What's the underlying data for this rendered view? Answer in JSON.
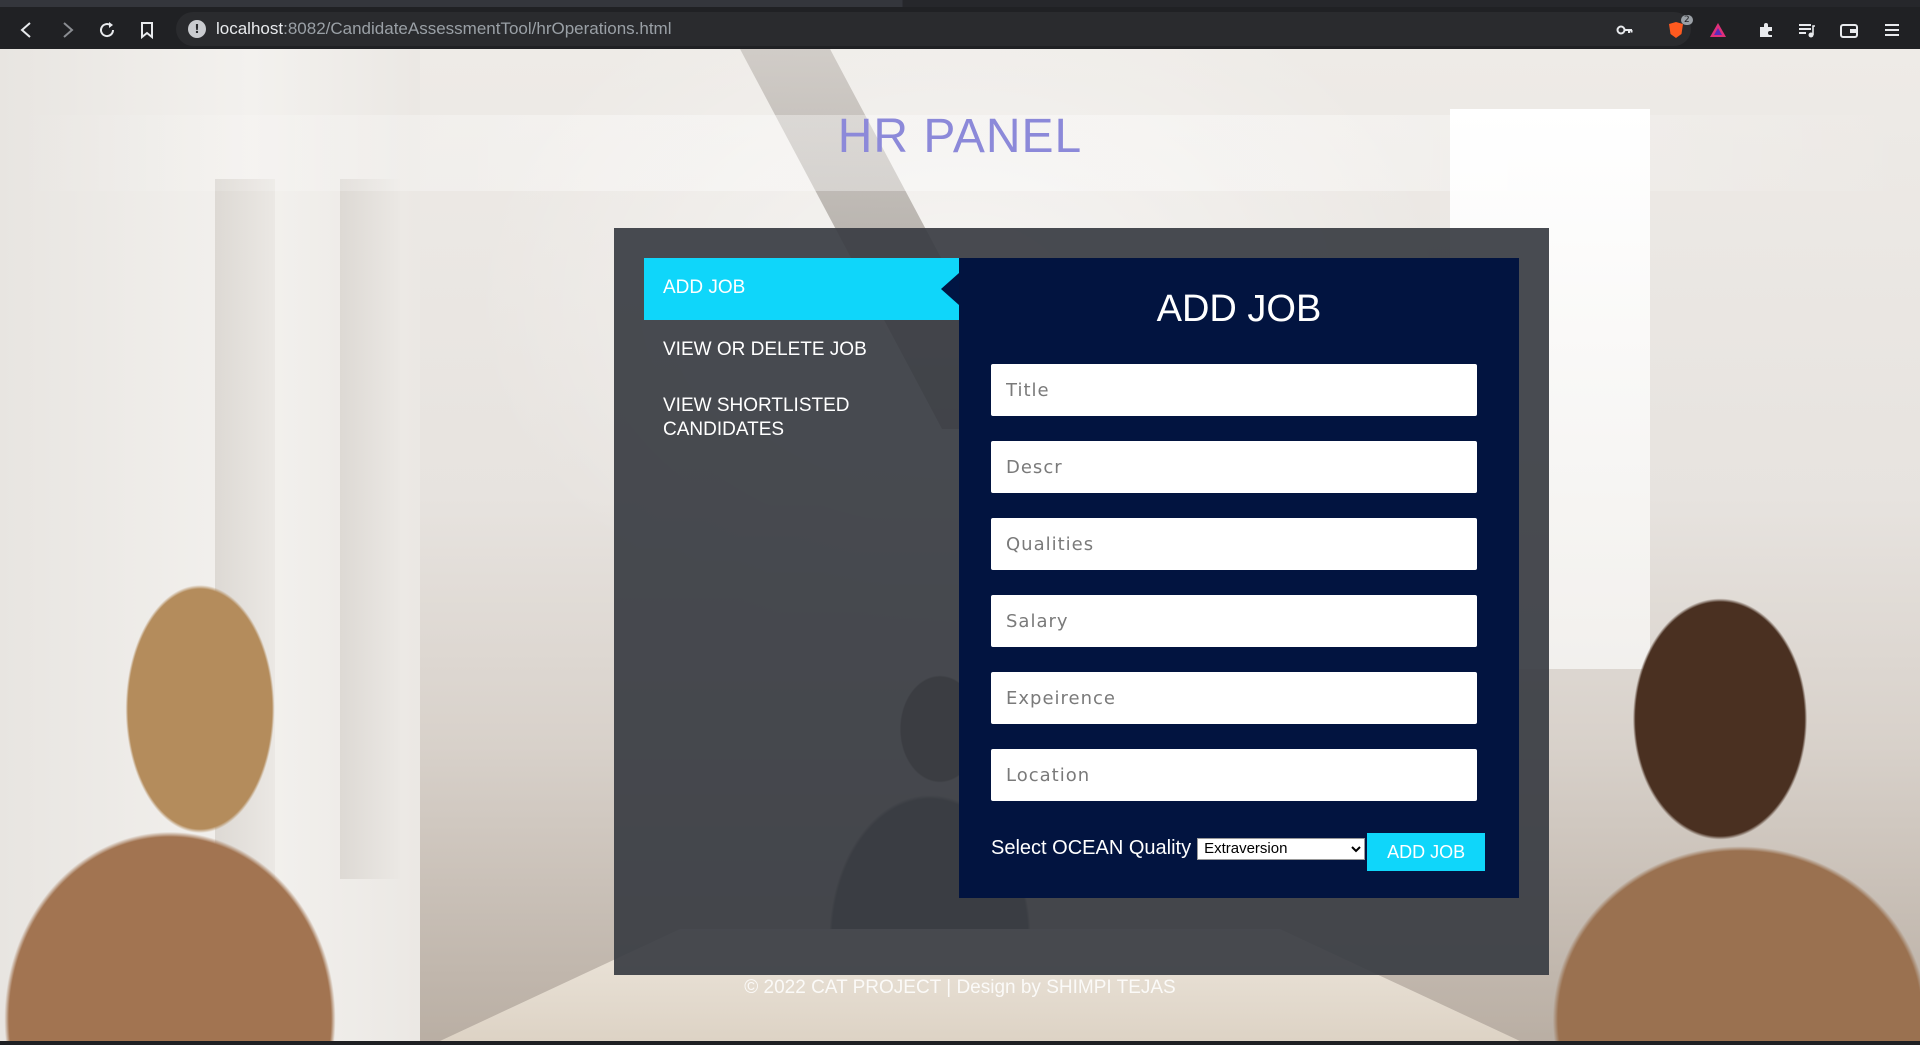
{
  "browser": {
    "url_host": "localhost",
    "url_rest": ":8082/CandidateAssessmentTool/hrOperations.html",
    "shield_badge": "2",
    "icons": {
      "back": "back-arrow-icon",
      "forward": "forward-arrow-icon",
      "reload": "reload-icon",
      "bookmark": "bookmark-icon",
      "site_info": "site-info-icon",
      "key": "key-icon",
      "brave_shield": "brave-shield-icon",
      "rewards": "brave-rewards-icon",
      "extensions": "puzzle-icon",
      "playlist": "playlist-icon",
      "wallet": "wallet-icon",
      "menu": "hamburger-menu-icon"
    }
  },
  "page": {
    "title": "HR PANEL",
    "menu": [
      {
        "label": "ADD JOB",
        "active": true
      },
      {
        "label": "VIEW OR DELETE JOB",
        "active": false
      },
      {
        "label": "VIEW SHORTLISTED CANDIDATES",
        "active": false
      }
    ],
    "form": {
      "title": "ADD JOB",
      "fields": [
        {
          "name": "title",
          "placeholder": "Title"
        },
        {
          "name": "descr",
          "placeholder": "Descr"
        },
        {
          "name": "qualities",
          "placeholder": "Qualities"
        },
        {
          "name": "salary",
          "placeholder": "Salary"
        },
        {
          "name": "experience",
          "placeholder": "Expeirence"
        },
        {
          "name": "location",
          "placeholder": "Location"
        }
      ],
      "quality_label": "Select OCEAN Quality",
      "quality_selected": "Extraversion",
      "submit_label": "ADD JOB"
    },
    "footer": "© 2022 CAT PROJECT | Design by SHIMPI TEJAS"
  },
  "colors": {
    "accent": "#0fd6fa",
    "form_bg": "#021440",
    "panel_bg": "#383c42",
    "title": "#8c89d9"
  }
}
